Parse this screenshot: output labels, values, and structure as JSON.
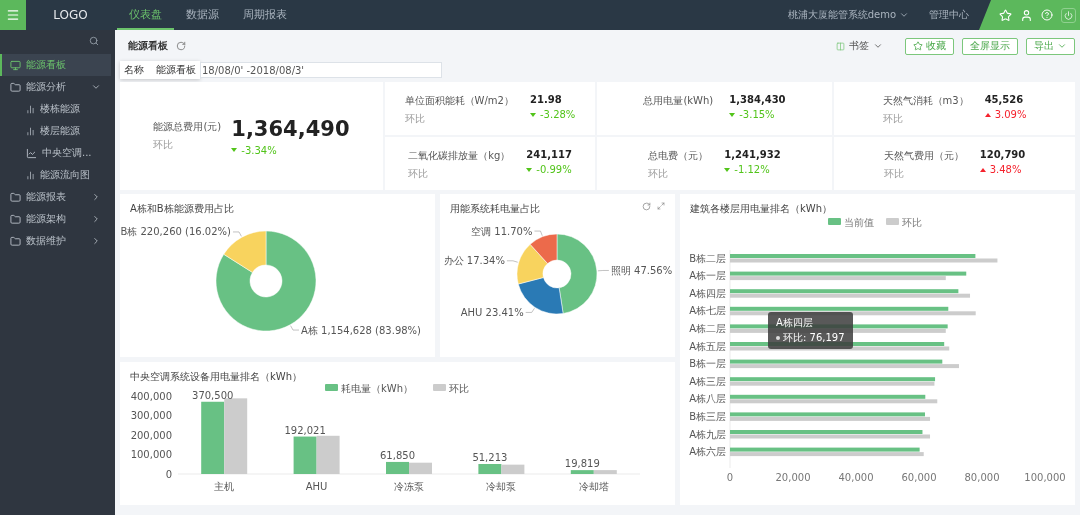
{
  "top_bar": {
    "logo": "LOGO",
    "tabs": [
      {
        "label": "仪表盘",
        "selected": true
      },
      {
        "label": "数据源",
        "selected": false
      },
      {
        "label": "周期报表",
        "selected": false
      }
    ],
    "project": "桃浦大厦能管系统demo",
    "admin": "管理中心"
  },
  "sidebar": {
    "items": [
      {
        "label": "能源看板",
        "kind": "page",
        "selected": true
      },
      {
        "label": "能源分析",
        "kind": "folder",
        "selected": false,
        "expanded": true,
        "children": [
          {
            "label": "楼栋能源",
            "kind": "bars",
            "selected": false
          },
          {
            "label": "楼层能源",
            "kind": "bars",
            "selected": false
          },
          {
            "label": "中央空调...",
            "kind": "line",
            "selected": false
          },
          {
            "label": "能源流向图",
            "kind": "bars",
            "selected": false
          }
        ]
      },
      {
        "label": "能源报表",
        "kind": "folder",
        "selected": false,
        "expanded": false
      },
      {
        "label": "能源架构",
        "kind": "folder",
        "selected": false,
        "expanded": false
      },
      {
        "label": "数据维护",
        "kind": "folder",
        "selected": false,
        "expanded": false
      }
    ]
  },
  "page_header": {
    "title": "能源看板",
    "bookmark": "书签",
    "buttons": [
      {
        "label": "收藏",
        "kind": "star"
      },
      {
        "label": "全屏显示",
        "kind": "plain"
      },
      {
        "label": "导出",
        "kind": "dropdown"
      }
    ]
  },
  "filter": {
    "tooltip_label": "名称",
    "tooltip_value": "能源看板",
    "date_value": "18/08/0' -2018/08/3'"
  },
  "main_kpi": {
    "label": "能源总费用(元)",
    "value": "1,364,490",
    "compare_label": "环比",
    "change": "-3.34%",
    "rising": false
  },
  "kpis": [
    {
      "label": "单位面积能耗（W/m2）",
      "value": "21.98",
      "compare_label": "环比",
      "change": "-3.28%",
      "rising": false
    },
    {
      "label": "总用电量(kWh)",
      "value": "1,384,430",
      "change": "-3.15%",
      "rising": false
    },
    {
      "label": "天然气消耗（m3）",
      "value": "45,526",
      "compare_label": "环比",
      "change": "3.09%",
      "rising": true
    },
    {
      "label": "二氧化碳排放量（kg）",
      "value": "241,117",
      "compare_label": "环比",
      "change": "-0.99%",
      "rising": false
    },
    {
      "label": "总电费（元）",
      "value": "1,241,932",
      "compare_label": "环比",
      "change": "-1.12%",
      "rising": false
    },
    {
      "label": "天然气费用（元）",
      "value": "120,790",
      "compare_label": "环比",
      "change": "3.48%",
      "rising": true
    }
  ],
  "building_pie": {
    "title": "A栋和B栋能源费用占比",
    "chart_data": {
      "type": "donut",
      "categories": [
        "A栋",
        "B栋"
      ],
      "values": [
        1154628,
        220260
      ],
      "colors": [
        "#68c184",
        "#f8d35e"
      ],
      "value_labels": [
        "1,154,628 (83.98%)",
        "220,260 (16.02%)"
      ]
    }
  },
  "system_pie": {
    "title": "用能系统耗电量占比",
    "chart_data": {
      "type": "donut",
      "categories": [
        "照明",
        "AHU",
        "办公",
        "空调"
      ],
      "values": [
        47.56,
        23.41,
        17.34,
        11.7
      ],
      "colors": [
        "#68c184",
        "#2a7ab5",
        "#f8d35e",
        "#ec6a4b"
      ],
      "value_labels": [
        "47.56%",
        "23.41%",
        "17.34%",
        "11.70%"
      ]
    }
  },
  "floor_chart": {
    "title": "建筑各楼层用电量排名（kWh）",
    "tooltip": {
      "title": "A栋四层",
      "text": "环比: 76,197"
    },
    "chart_data": {
      "type": "bar",
      "orientation": "horizontal",
      "categories": [
        "B栋二层",
        "A栋一层",
        "A栋四层",
        "A栋七层",
        "A栋二层",
        "A栋五层",
        "B栋一层",
        "A栋三层",
        "A栋八层",
        "B栋三层",
        "A栋九层",
        "A栋六层"
      ],
      "series": [
        {
          "name": "当前值",
          "color": "#68c184",
          "values": [
            77900,
            75000,
            72500,
            69300,
            69100,
            68000,
            67400,
            65100,
            62000,
            61900,
            61100,
            60200
          ]
        },
        {
          "name": "环比",
          "color": "#cccccc",
          "values": [
            84900,
            68500,
            76200,
            78000,
            68500,
            69600,
            72700,
            64900,
            65800,
            63500,
            63500,
            61500
          ]
        }
      ],
      "legend": "top",
      "xlim": [
        0,
        100000
      ],
      "xticks": [
        {
          "value": 0,
          "label": "0"
        },
        {
          "value": 20000,
          "label": "20,000"
        },
        {
          "value": 40000,
          "label": "40,000"
        },
        {
          "value": 60000,
          "label": "60,000"
        },
        {
          "value": 80000,
          "label": "80,000"
        },
        {
          "value": 100000,
          "label": "100,000"
        }
      ]
    }
  },
  "hvac_chart": {
    "title": "中央空调系统设备用电量排名（kWh）",
    "chart_data": {
      "type": "bar",
      "categories": [
        "主机",
        "AHU",
        "冷冻泵",
        "冷却泵",
        "冷却塔"
      ],
      "series": [
        {
          "name": "耗电量（kWh）",
          "color": "#68c184",
          "values": [
            370500,
            192021,
            61850,
            51213,
            19819
          ],
          "value_labels": [
            "370,500",
            "192,021",
            "61,850",
            "51,213",
            "19,819"
          ]
        },
        {
          "name": "环比",
          "color": "#cccccc",
          "values": [
            388000,
            196000,
            58000,
            48000,
            20000
          ]
        }
      ],
      "legend": "top",
      "ylim": [
        0,
        400000
      ],
      "yticks": [
        {
          "value": 0,
          "label": "0"
        },
        {
          "value": 100000,
          "label": "100,000"
        },
        {
          "value": 200000,
          "label": "200,000"
        },
        {
          "value": 300000,
          "label": "300,000"
        },
        {
          "value": 400000,
          "label": "400,000"
        }
      ]
    }
  }
}
